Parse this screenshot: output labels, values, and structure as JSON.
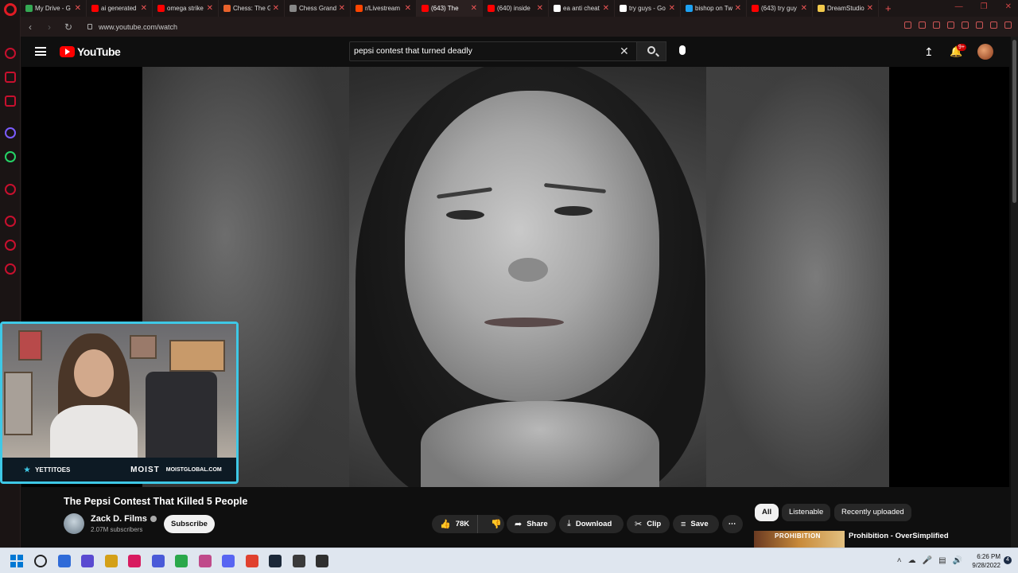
{
  "browser": {
    "tabs": [
      {
        "title": "My Drive - G",
        "color": "#34a853",
        "active": false
      },
      {
        "title": "ai generated",
        "color": "#ff0000",
        "active": false
      },
      {
        "title": "omega strike",
        "color": "#ff0000",
        "active": false
      },
      {
        "title": "Chess: The G",
        "color": "#e8622c",
        "active": false
      },
      {
        "title": "Chess Grand",
        "color": "#888888",
        "active": false
      },
      {
        "title": "r/Livestream",
        "color": "#ff4500",
        "active": false
      },
      {
        "title": "(643) The",
        "color": "#ff0000",
        "active": true
      },
      {
        "title": "(640) inside",
        "color": "#ff0000",
        "active": false
      },
      {
        "title": "ea anti cheat",
        "color": "#ffffff",
        "active": false
      },
      {
        "title": "try guys - Go",
        "color": "#ffffff",
        "active": false
      },
      {
        "title": "bishop on Tw",
        "color": "#1da1f2",
        "active": false
      },
      {
        "title": "(643) try guy",
        "color": "#ff0000",
        "active": false
      },
      {
        "title": "DreamStudio",
        "color": "#f2c94c",
        "active": false
      }
    ],
    "url": "www.youtube.com/watch"
  },
  "youtube": {
    "logo_text": "YouTube",
    "search_query": "pepsi contest that turned deadly",
    "notification_count": "9+"
  },
  "webcam": {
    "handle": "YETTITOES",
    "brand": "MOIST",
    "site": "MOISTGLOBAL.COM"
  },
  "video": {
    "title": "The Pepsi Contest That Killed 5 People",
    "channel": "Zack D. Films",
    "subscribers": "2.07M subscribers",
    "subscribe_label": "Subscribe",
    "likes": "78K",
    "share_label": "Share",
    "download_label": "Download",
    "clip_label": "Clip",
    "save_label": "Save"
  },
  "sidebar_chips": [
    "All",
    "Listenable",
    "Recently uploaded"
  ],
  "recommendation": {
    "thumb_text": "PROHIBITION",
    "title": "Prohibition - OverSimplified"
  },
  "taskbar": {
    "time": "6:26 PM",
    "date": "9/28/2022",
    "notification_count": "4",
    "app_colors": [
      "#1e1e1e",
      "#2f6bd8",
      "#5a4ad1",
      "#d4a017",
      "#d81b60",
      "#4a5ad8",
      "#2aa84a",
      "#c04a8a",
      "#5865f2",
      "#e0412f",
      "#1b2838",
      "#3a3a3a",
      "#2f2f2f"
    ]
  }
}
